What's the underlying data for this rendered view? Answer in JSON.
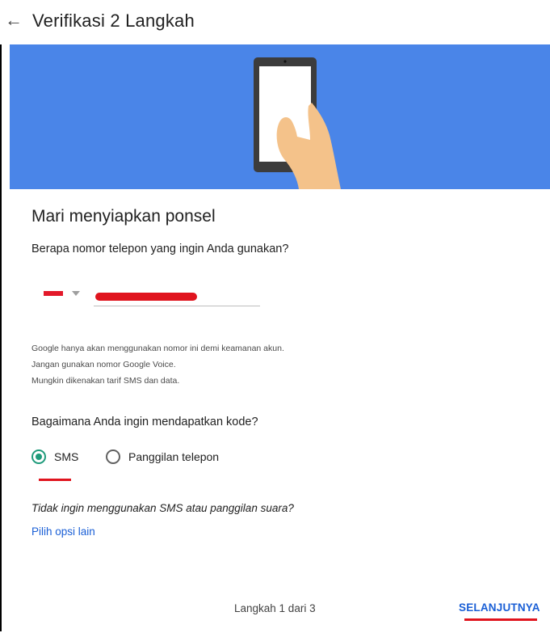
{
  "header": {
    "title": "Verifikasi 2 Langkah",
    "back_icon": "arrow-left-icon"
  },
  "hero": {
    "background_color": "#4a85e8",
    "illustration": "hand-holding-phone-illustration"
  },
  "main": {
    "heading": "Mari menyiapkan ponsel",
    "phone_question": "Berapa nomor telepon yang ingin Anda gunakan?",
    "phone_input": {
      "value": "",
      "redacted": true
    },
    "notes": [
      "Google hanya akan menggunakan nomor ini demi keamanan akun.",
      "Jangan gunakan nomor Google Voice.",
      "Mungkin dikenakan tarif SMS dan data."
    ],
    "code_question": "Bagaimana Anda ingin mendapatkan kode?",
    "options": [
      {
        "label": "SMS",
        "selected": true
      },
      {
        "label": "Panggilan telepon",
        "selected": false
      }
    ],
    "alt_question": "Tidak ingin menggunakan SMS atau panggilan suara?",
    "alt_link": "Pilih opsi lain"
  },
  "footer": {
    "step_text": "Langkah 1 dari 3",
    "next_label": "SELANJUTNYA"
  },
  "colors": {
    "accent": "#1a5fd6",
    "radio_selected": "#1f9b7b",
    "annotation_red": "#e0141e"
  }
}
